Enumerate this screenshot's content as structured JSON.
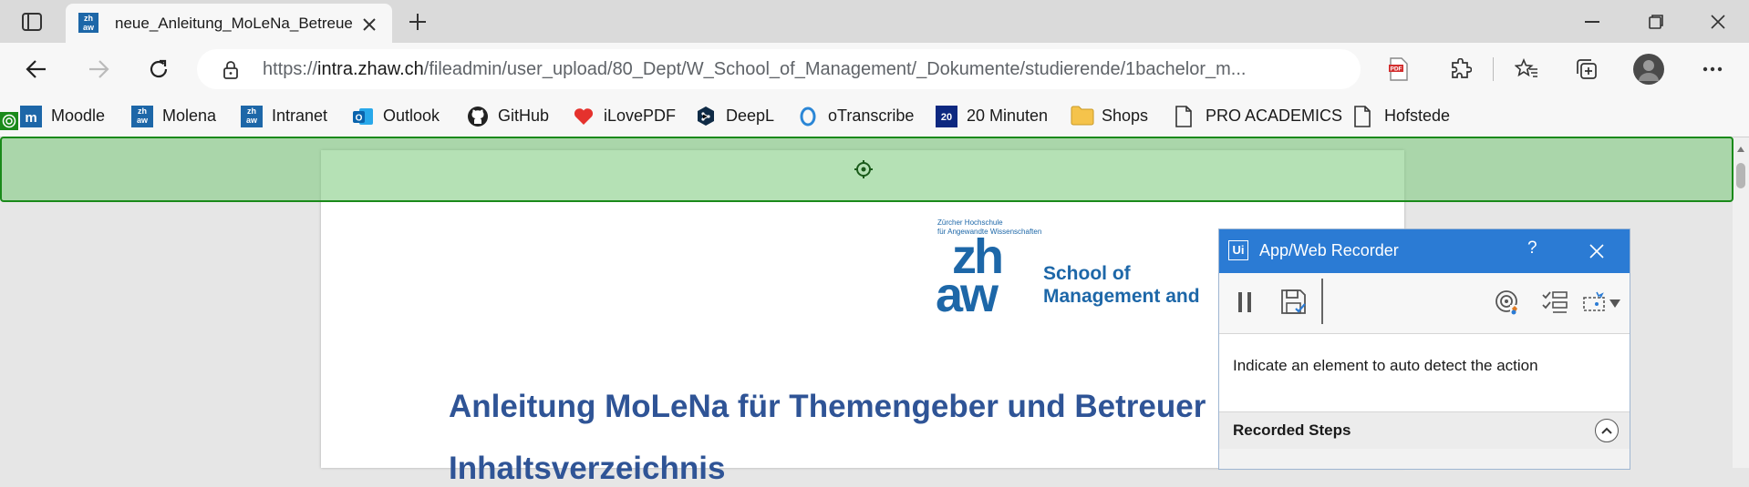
{
  "browser": {
    "tab": {
      "title": "neue_Anleitung_MoLeNa_Betreuer",
      "favicon": "zhaw-icon"
    },
    "url": {
      "prefix": "https://",
      "host": "intra.zhaw.ch",
      "path": "/fileadmin/user_upload/80_Dept/W_School_of_Management/_Dokumente/studierende/1bachelor_m..."
    },
    "bookmarks": [
      {
        "label": "Moodle",
        "icon": "moodle-icon"
      },
      {
        "label": "Molena",
        "icon": "zhaw-icon"
      },
      {
        "label": "Intranet",
        "icon": "zhaw-icon"
      },
      {
        "label": "Outlook",
        "icon": "outlook-icon"
      },
      {
        "label": "GitHub",
        "icon": "github-icon"
      },
      {
        "label": "iLovePDF",
        "icon": "heart-icon"
      },
      {
        "label": "DeepL",
        "icon": "deepl-icon"
      },
      {
        "label": "oTranscribe",
        "icon": "otranscribe-icon"
      },
      {
        "label": "20 Minuten",
        "icon": "20min-icon"
      },
      {
        "label": "Shops",
        "icon": "folder-icon"
      },
      {
        "label": "PRO ACADEMICS",
        "icon": "page-icon"
      },
      {
        "label": "Hofstede",
        "icon": "page-icon"
      }
    ]
  },
  "document": {
    "logo": {
      "top_line1": "Zürcher Hochschule",
      "top_line2": "für Angewandte Wissenschaften",
      "mark_zh": "zh",
      "mark_aw": "aw",
      "school_line1": "School of",
      "school_line2": "Management and"
    },
    "title": "Anleitung MoLeNa für Themengeber und Betreuer",
    "subtitle": "Inhaltsverzeichnis"
  },
  "recorder": {
    "title": "App/Web Recorder",
    "logo_text": "Ui",
    "help": "?",
    "instruction": "Indicate an element to auto detect the action",
    "steps_header": "Recorded Steps"
  },
  "colors": {
    "accent": "#2b7bd4",
    "zhaw_blue": "#1d67a8",
    "title_blue": "#2f5496",
    "highlight": "#78c878"
  }
}
